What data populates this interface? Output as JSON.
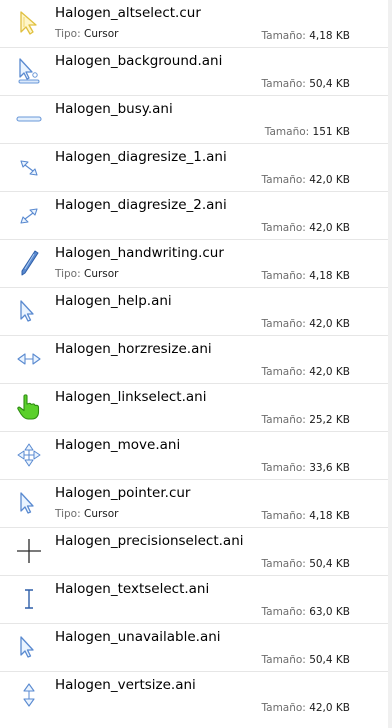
{
  "labels": {
    "type": "Tipo:",
    "size": "Tamaño:"
  },
  "files": [
    {
      "name": "Halogen_altselect.cur",
      "type": "Cursor",
      "size": "4,18 KB",
      "icon": "alt-select-cursor-icon"
    },
    {
      "name": "Halogen_background.ani",
      "type": "",
      "size": "50,4 KB",
      "icon": "background-cursor-icon"
    },
    {
      "name": "Halogen_busy.ani",
      "type": "",
      "size": "151 KB",
      "icon": "busy-cursor-icon"
    },
    {
      "name": "Halogen_diagresize_1.ani",
      "type": "",
      "size": "42,0 KB",
      "icon": "diagonal-resize-1-icon"
    },
    {
      "name": "Halogen_diagresize_2.ani",
      "type": "",
      "size": "42,0 KB",
      "icon": "diagonal-resize-2-icon"
    },
    {
      "name": "Halogen_handwriting.cur",
      "type": "Cursor",
      "size": "4,18 KB",
      "icon": "handwriting-pen-icon"
    },
    {
      "name": "Halogen_help.ani",
      "type": "",
      "size": "42,0 KB",
      "icon": "help-cursor-icon"
    },
    {
      "name": "Halogen_horzresize.ani",
      "type": "",
      "size": "42,0 KB",
      "icon": "horizontal-resize-icon"
    },
    {
      "name": "Halogen_linkselect.ani",
      "type": "",
      "size": "25,2 KB",
      "icon": "hand-link-select-icon"
    },
    {
      "name": "Halogen_move.ani",
      "type": "",
      "size": "33,6 KB",
      "icon": "move-cursor-icon"
    },
    {
      "name": "Halogen_pointer.cur",
      "type": "Cursor",
      "size": "4,18 KB",
      "icon": "pointer-cursor-icon"
    },
    {
      "name": "Halogen_precisionselect.ani",
      "type": "",
      "size": "50,4 KB",
      "icon": "precision-crosshair-icon"
    },
    {
      "name": "Halogen_textselect.ani",
      "type": "",
      "size": "63,0 KB",
      "icon": "text-ibeam-icon"
    },
    {
      "name": "Halogen_unavailable.ani",
      "type": "",
      "size": "50,4 KB",
      "icon": "unavailable-cursor-icon"
    },
    {
      "name": "Halogen_vertsize.ani",
      "type": "",
      "size": "42,0 KB",
      "icon": "vertical-resize-icon"
    }
  ]
}
